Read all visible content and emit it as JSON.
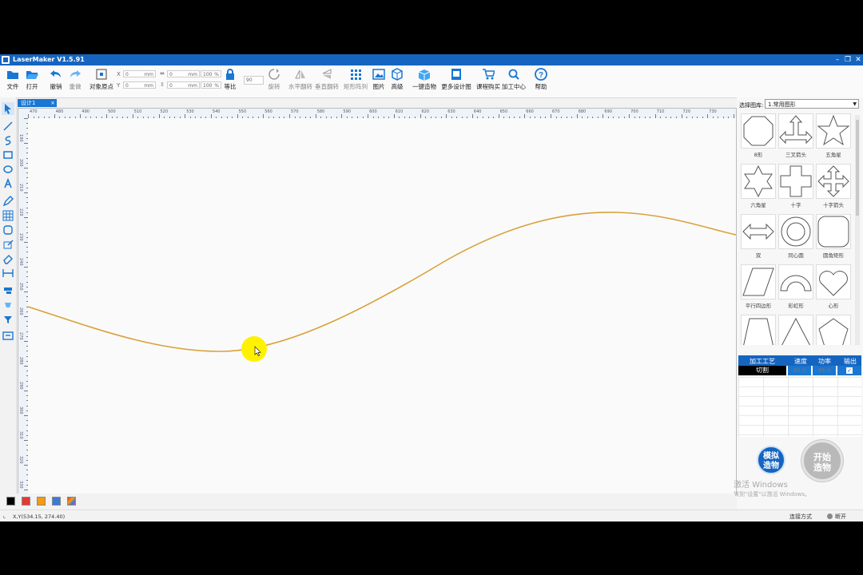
{
  "app": {
    "title": "LaserMaker V1.5.91"
  },
  "toolbar": {
    "file": "文件",
    "open": "打开",
    "undo": "撤销",
    "redo": "重做",
    "origin": "对象原点",
    "x_label": "X",
    "y_label": "Y",
    "x_value": "0",
    "y_value": "0",
    "unit_mm": "mm",
    "w_value": "0",
    "h_value": "0",
    "pct": "100",
    "pct_sign": "%",
    "lock": "等比",
    "angle": "90",
    "rotate": "旋转",
    "hflip": "水平翻转",
    "vflip": "垂直翻转",
    "array": "矩形阵列",
    "image": "图片",
    "advanced": "高级",
    "one_key": "一键造物",
    "more_designs": "更多设计图",
    "course": "课程购买",
    "center": "加工中心",
    "help": "帮助"
  },
  "document": {
    "tab_label": "设计1",
    "close": "×"
  },
  "ruler": {
    "top": [
      "470",
      "480",
      "490",
      "500",
      "510",
      "520",
      "530",
      "540",
      "550",
      "560",
      "570",
      "580",
      "590",
      "600",
      "610",
      "620",
      "630",
      "640",
      "650",
      "660",
      "670",
      "680",
      "690",
      "700",
      "710",
      "720",
      "730"
    ],
    "left": [
      "190",
      "200",
      "210",
      "220",
      "230",
      "240",
      "250",
      "260",
      "270",
      "280",
      "290",
      "300",
      "310",
      "320",
      "330"
    ]
  },
  "library": {
    "label": "选择图库:",
    "selected": "1.常用图形",
    "shapes": [
      {
        "name": "8形"
      },
      {
        "name": "三叉箭头"
      },
      {
        "name": "五角星"
      },
      {
        "name": "六角星"
      },
      {
        "name": "十字"
      },
      {
        "name": "十字箭头"
      },
      {
        "name": "双"
      },
      {
        "name": "同心圆"
      },
      {
        "name": "圆角矩形"
      },
      {
        "name": "平行四边形"
      },
      {
        "name": "彩虹形"
      },
      {
        "name": "心形"
      },
      {
        "name": ""
      },
      {
        "name": ""
      },
      {
        "name": ""
      }
    ]
  },
  "process": {
    "headers": [
      "加工工艺",
      "速度",
      "功率",
      "输出"
    ],
    "rows": [
      {
        "type": "切割",
        "speed": "60.0",
        "power": "99.0",
        "output_checked": true
      }
    ]
  },
  "buttons": {
    "simulate": "模拟造物",
    "start": "开始造物"
  },
  "watermark": {
    "line1": "激活 Windows",
    "line2": "转到\"设置\"以激活 Windows。"
  },
  "palette": {
    "colors": [
      "#000000",
      "#e53935",
      "#f39c12",
      "#3a7bd5",
      "#d14db3"
    ]
  },
  "status": {
    "coords": "X,Y(534.15, 274.40)",
    "connection": "连接方式",
    "state": "断开"
  },
  "colors": {
    "accent": "#1565c0",
    "curve": "#d9a13a",
    "cursor_highlight": "#fff200"
  }
}
